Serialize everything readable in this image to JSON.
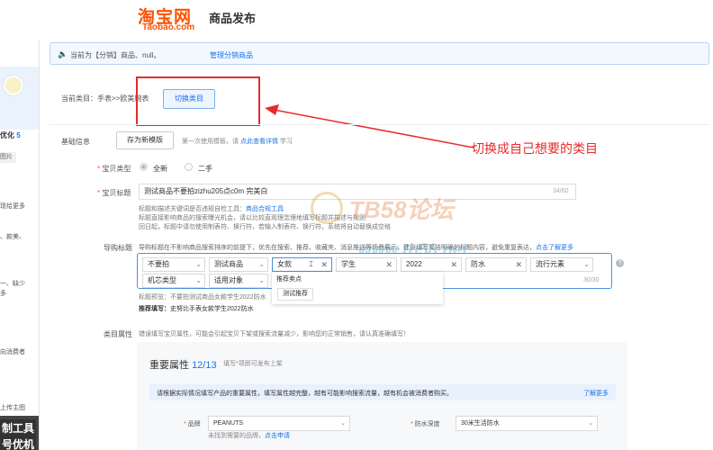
{
  "header": {
    "logo_cn": "淘宝网",
    "logo_en": "Taobao.com",
    "title": "商品发布"
  },
  "sidebar": {
    "optimize_prefix": "优化",
    "optimize_count": "5",
    "tag": "图片",
    "text1": "现给更多",
    "text2": "、款美、",
    "text3": "一、缺少",
    "text4": "多",
    "text5": "向消费者",
    "upload_label": "上传主图",
    "badge1": "制工具",
    "badge2": "号优机"
  },
  "notice": {
    "icon": "speaker-icon",
    "text": "当前为【分销】商品、null。",
    "link": "管理分销商品"
  },
  "category": {
    "label": "当前类目：手表>>欧美腕表",
    "switch_button": "切换类目"
  },
  "annotation": {
    "text": "切换成自己想要的类目",
    "color": "#e62b2b"
  },
  "basic": {
    "label": "基础信息",
    "save_template": "存为新模版",
    "hint_prefix": "第一次使用模板，请",
    "hint_link": "点此查看详情",
    "hint_suffix": "学习"
  },
  "baby_type": {
    "label": "宝贝类型",
    "option_new": "全新",
    "option_used": "二手"
  },
  "baby_title": {
    "label": "宝贝标题",
    "value": "测试商品不要拍zizhu205点c0m 完美白",
    "count": "34/60",
    "help1_prefix": "标题和描述关键词是否违规自检工具：",
    "help1_link": "商品合规工具",
    "help2": "标题直接影响商品的搜索曝光机会，请以比较直观理念理地填写标题并描述与规则",
    "help3": "回日起，标题中请勿使用制表符、换行符，若输入制表符、换行符，系统将自动替换成空格"
  },
  "watermark": {
    "text1": "TB58论坛",
    "text2": "www.tb58.net"
  },
  "guide_title": {
    "label": "导购标题",
    "help_prefix": "导购标题在不影响商品搜索排序的前提下，优先在搜索、推荐、收藏夹、消息推送等场景展示，建议填写简洁明确的标题内容，避免重复表达，",
    "help_link": "点击了解更多",
    "chips": [
      "不要拍",
      "测试商品",
      "女款",
      "学生",
      "2022",
      "防水",
      "流行元素",
      "机芯类型",
      "适用对象"
    ],
    "count": "30/30",
    "dropdown_title": "推荐卖点",
    "dropdown_item": "测试推荐",
    "preview": "标题预览：不要拍测试商品女款学生2022防水",
    "rec_label": "推荐填写：",
    "rec_value": "史努比手表女款学生2022防水"
  },
  "attributes": {
    "label": "类目属性",
    "hint": "错误填写宝贝属性，可能会引起宝贝下架或搜索流量减少，影响您的正常销售，请认真准确填写！",
    "panel_title": "重要属性",
    "panel_count": "12/13",
    "panel_sub": "填写*项即可发布上架",
    "notice_text": "请根据实际情况填写产品的重要属性，填写属性越完整，越有可能影响搜索流量，越有机会被消费者购买。",
    "notice_link": "了解更多",
    "brand_label": "品牌",
    "brand_value": "PEANUTS",
    "water_label": "防水深度",
    "water_value": "30米生活防水",
    "brand_missing_prefix": "未找到需要的品牌，",
    "brand_missing_link": "点击申请"
  }
}
